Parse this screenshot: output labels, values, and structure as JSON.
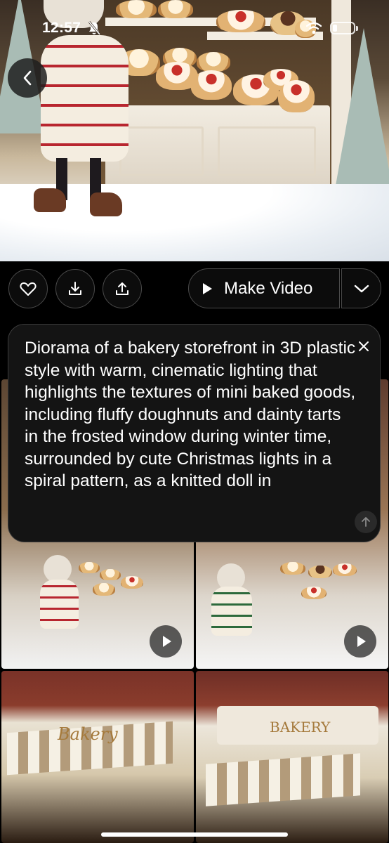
{
  "status_bar": {
    "time": "12:57"
  },
  "actions": {
    "make_video_label": "Make Video"
  },
  "prompt": {
    "text": "Diorama of a bakery storefront in 3D plastic style with warm, cinematic lighting that highlights the textures of mini baked goods, including fluffy doughnuts and dainty tarts in the frosted window during winter time, surrounded by cute Christmas lights in a spiral pattern, as a knitted doll in"
  },
  "thumbnails": [
    {
      "sign_text": ""
    },
    {
      "sign_text": ""
    },
    {
      "sign_text": "Bakery"
    },
    {
      "sign_text": "BAKERY"
    }
  ],
  "icons": {
    "back": "chevron-left-icon",
    "like": "heart-icon",
    "download": "download-icon",
    "share": "share-icon",
    "dropdown": "chevron-down-icon",
    "close": "close-icon",
    "scroll_up": "arrow-up-icon",
    "play": "play-icon"
  },
  "colors": {
    "background": "#000000",
    "card": "#141414",
    "border": "#4a4a4a",
    "text": "#ffffff"
  }
}
